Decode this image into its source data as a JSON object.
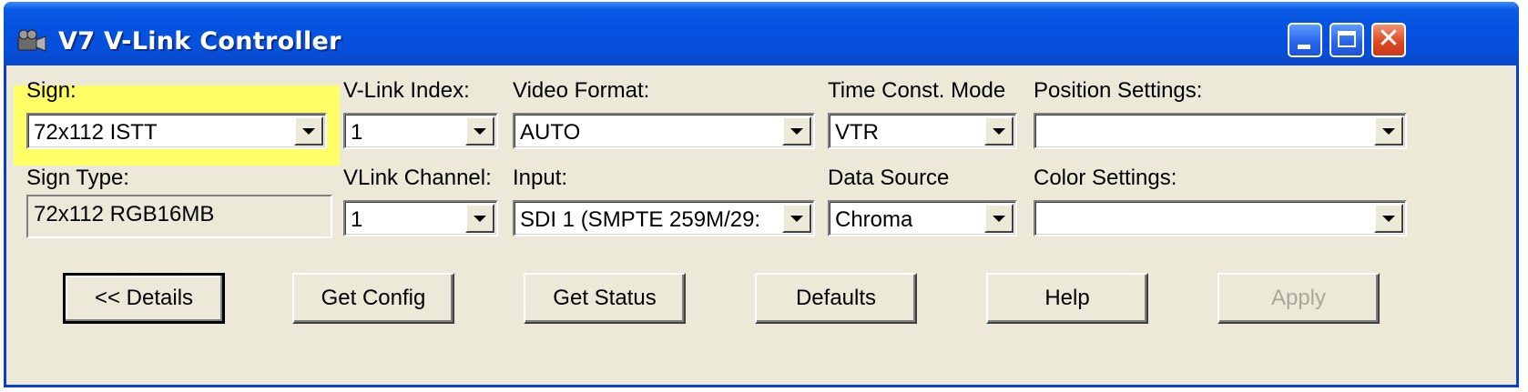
{
  "window": {
    "title": "V7 V-Link Controller",
    "icon": "camera-app-icon",
    "controls": [
      "minimize-icon",
      "maximize-icon",
      "close-icon"
    ],
    "highlight_color": "#ffff66",
    "titlebar_color": "#0453e0"
  },
  "fields": {
    "sign": {
      "label": "Sign:",
      "value": "72x112 ISTT"
    },
    "sign_type": {
      "label": "Sign Type:",
      "value": "72x112 RGB16MB"
    },
    "vlink_index": {
      "label": "V-Link Index:",
      "value": "1"
    },
    "vlink_channel": {
      "label": "VLink Channel:",
      "value": "1"
    },
    "video_format": {
      "label": "Video Format:",
      "value": "AUTO"
    },
    "input": {
      "label": "Input:",
      "value": "SDI 1 (SMPTE 259M/29:"
    },
    "time_const_mode": {
      "label": "Time Const. Mode",
      "value": "VTR"
    },
    "data_source": {
      "label": "Data Source",
      "value": "Chroma"
    },
    "position_settings": {
      "label": "Position Settings:",
      "value": ""
    },
    "color_settings": {
      "label": "Color Settings:",
      "value": ""
    }
  },
  "buttons": {
    "details": "<< Details",
    "get_config": "Get Config",
    "get_status": "Get Status",
    "defaults": "Defaults",
    "help": "Help",
    "apply": "Apply"
  }
}
